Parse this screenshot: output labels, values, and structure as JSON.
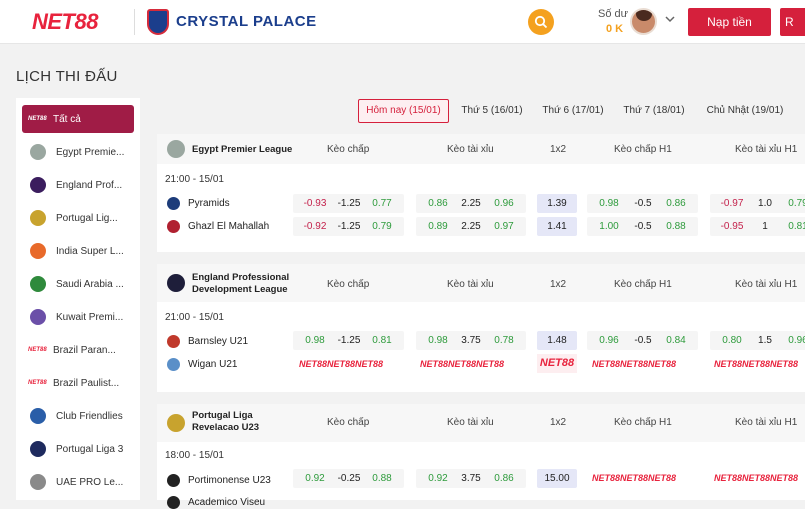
{
  "header": {
    "logo": "NET88",
    "partner": "CRYSTAL PALACE",
    "balance_label": "Số dư",
    "balance_value": "0 K",
    "deposit_label": "Nạp tiền",
    "second_button_label": "R",
    "accent_color": "#d5203c",
    "gold_color": "#f4a11f"
  },
  "page_title": "LỊCH THI ĐẤU",
  "sidebar": {
    "items": [
      {
        "label": "Tất cả",
        "tag": "NET88",
        "active": true
      },
      {
        "label": "Egypt Premie...",
        "icon_color": "#9aa7a0"
      },
      {
        "label": "England Prof...",
        "icon_color": "#3b1d5e"
      },
      {
        "label": "Portugal Lig...",
        "icon_color": "#c8a32e"
      },
      {
        "label": "India Super L...",
        "icon_color": "#e86a2a"
      },
      {
        "label": "Saudi Arabia ...",
        "icon_color": "#2f8a3c"
      },
      {
        "label": "Kuwait Premi...",
        "icon_color": "#6b4fa8"
      },
      {
        "label": "Brazil Paran...",
        "tag": "NET88"
      },
      {
        "label": "Brazil Paulist...",
        "tag": "NET88"
      },
      {
        "label": "Club Friendlies",
        "icon_color": "#2a5ea8"
      },
      {
        "label": "Portugal Liga 3",
        "icon_color": "#1e2a5e"
      },
      {
        "label": "UAE PRO Le...",
        "icon_color": "#8a8a8a"
      }
    ]
  },
  "tabs": [
    "Hôm nay (15/01)",
    "Thứ 5 (16/01)",
    "Thứ 6 (17/01)",
    "Thứ 7 (18/01)",
    "Chủ Nhật (19/01)"
  ],
  "columns": [
    "Kèo chấp",
    "Kèo tài xỉu",
    "1x2",
    "Kèo chấp H1",
    "Kèo tài xỉu H1"
  ],
  "locked_label": "NET88",
  "leagues": [
    {
      "name": "Egypt Premier League",
      "time": "21:00 - 15/01",
      "teams": [
        {
          "name": "Pyramids",
          "handicap": [
            "-0.93",
            "-1.25",
            "0.77"
          ],
          "over_under": [
            "0.86",
            "2.25",
            "0.96"
          ],
          "x12": "1.39",
          "h1_handicap": [
            "0.98",
            "-0.5",
            "0.86"
          ],
          "h1_over_under": [
            "-0.97",
            "1.0",
            "0.79"
          ]
        },
        {
          "name": "Ghazl El Mahallah",
          "handicap": [
            "-0.92",
            "-1.25",
            "0.79"
          ],
          "over_under": [
            "0.89",
            "2.25",
            "0.97"
          ],
          "x12": "1.41",
          "h1_handicap": [
            "1.00",
            "-0.5",
            "0.88"
          ],
          "h1_over_under": [
            "-0.95",
            "1",
            "0.81"
          ]
        }
      ]
    },
    {
      "name": "England Professional Development League",
      "time": "21:00 - 15/01",
      "teams": [
        {
          "name": "Barnsley U21",
          "handicap": [
            "0.98",
            "-1.25",
            "0.81"
          ],
          "over_under": [
            "0.98",
            "3.75",
            "0.78"
          ],
          "x12": "1.48",
          "h1_handicap": [
            "0.96",
            "-0.5",
            "0.84"
          ],
          "h1_over_under": [
            "0.80",
            "1.5",
            "0.96"
          ]
        },
        {
          "name": "Wigan U21"
        }
      ]
    },
    {
      "name": "Portugal Liga Revelacao U23",
      "time": "18:00 - 15/01",
      "teams": [
        {
          "name": "Portimonense U23",
          "handicap": [
            "0.92",
            "-0.25",
            "0.88"
          ],
          "over_under": [
            "0.92",
            "3.75",
            "0.86"
          ],
          "x12": "15.00"
        },
        {
          "name": "Academico Viseu"
        }
      ]
    }
  ]
}
